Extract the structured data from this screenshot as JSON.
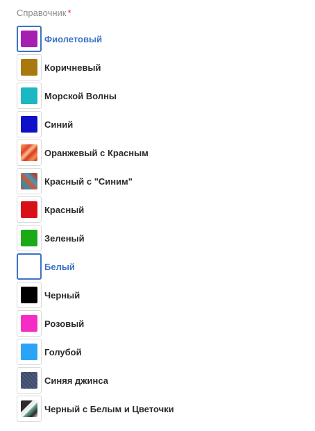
{
  "field": {
    "label": "Справочник",
    "required_mark": "*"
  },
  "options": [
    {
      "label": "Фиолетовый",
      "color": "#a51fb0",
      "selected": true
    },
    {
      "label": "Коричневый",
      "color": "#a9780f",
      "selected": false
    },
    {
      "label": "Морской Волны",
      "color": "#1bb7c3",
      "selected": false
    },
    {
      "label": "Синий",
      "color": "#1010c8",
      "selected": false
    },
    {
      "label": "Оранжевый с Красным",
      "pattern": "orange-red",
      "selected": false
    },
    {
      "label": "Красный с \"Синим\"",
      "pattern": "red-blue",
      "selected": false
    },
    {
      "label": "Красный",
      "color": "#d81117",
      "selected": false
    },
    {
      "label": "Зеленый",
      "color": "#1aaa16",
      "selected": false
    },
    {
      "label": "Белый",
      "color": "#ffffff",
      "selected": true
    },
    {
      "label": "Черный",
      "color": "#000000",
      "selected": false
    },
    {
      "label": "Розовый",
      "color": "#f52dc4",
      "selected": false
    },
    {
      "label": "Голубой",
      "color": "#2ba4f7",
      "selected": false
    },
    {
      "label": "Синяя джинса",
      "pattern": "denim",
      "selected": false
    },
    {
      "label": "Черный с Белым и Цветочки",
      "pattern": "black-white-flowers",
      "selected": false
    }
  ]
}
